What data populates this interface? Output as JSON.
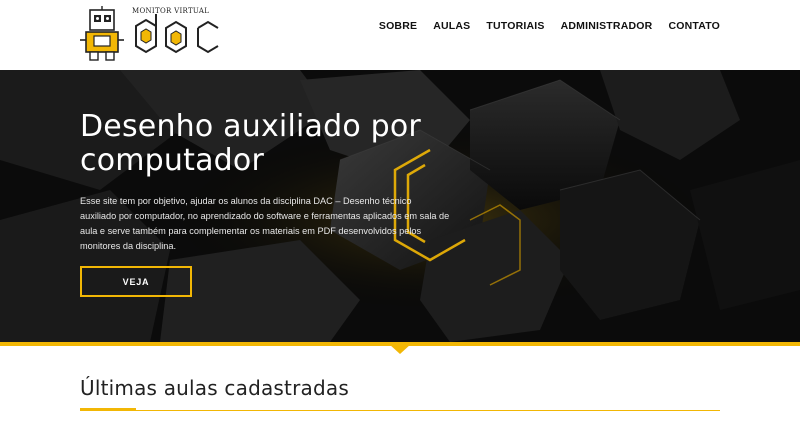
{
  "brand": {
    "subtitle": "Monitor Virtual",
    "logo_text": "dac",
    "accent_color": "#f2b705"
  },
  "nav": {
    "items": [
      {
        "label": "SOBRE"
      },
      {
        "label": "AULAS"
      },
      {
        "label": "TUTORIAIS"
      },
      {
        "label": "ADMINISTRADOR"
      },
      {
        "label": "CONTATO"
      }
    ]
  },
  "hero": {
    "title": "Desenho auxiliado por computador",
    "description": "Esse site tem por objetivo, ajudar os alunos da disciplina DAC – Desenho técnico auxiliado por computador, no aprendizado do software e ferramentas aplicados em sala de aula e serve também para complementar os materiais em PDF desenvolvidos pelos monitores da disciplina.",
    "button_label": "VEJA"
  },
  "section": {
    "title": "Últimas aulas cadastradas"
  }
}
